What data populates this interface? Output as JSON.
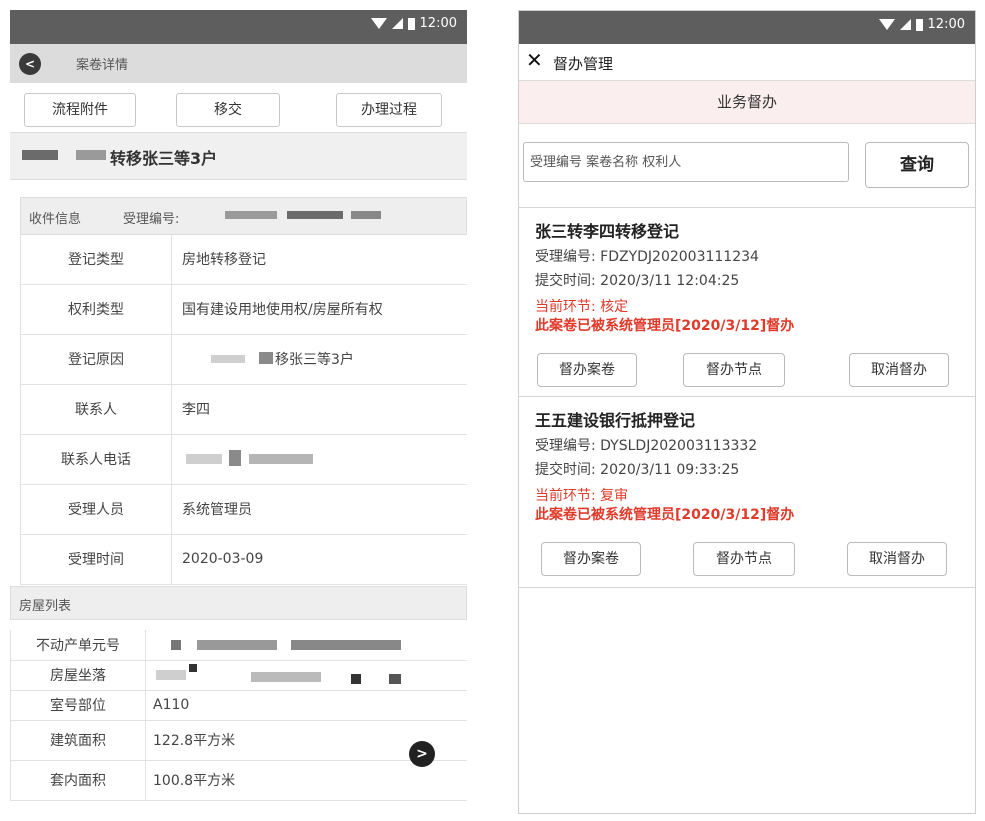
{
  "status": {
    "time": "12:00"
  },
  "left": {
    "nav_title": "案卷详情",
    "tabs": [
      "流程附件",
      "移交",
      "办理过程"
    ],
    "case_title": "转移张三等3户",
    "receipt": {
      "section": "收件信息",
      "receipt_no_label": "受理编号:"
    },
    "fields": [
      {
        "label": "登记类型",
        "value": "房地转移登记"
      },
      {
        "label": "权利类型",
        "value": "国有建设用地使用权/房屋所有权"
      },
      {
        "label": "登记原因",
        "value": "移张三等3户"
      },
      {
        "label": "联系人",
        "value": "李四"
      },
      {
        "label": "联系人电话",
        "value": ""
      },
      {
        "label": "受理人员",
        "value": "系统管理员"
      },
      {
        "label": "受理时间",
        "value": "2020-03-09"
      }
    ],
    "house_section": "房屋列表",
    "house_fields": [
      {
        "label": "不动产单元号",
        "value": ""
      },
      {
        "label": "房屋坐落",
        "value": ""
      },
      {
        "label": "室号部位",
        "value": "A110"
      },
      {
        "label": "建筑面积",
        "value": "122.8平方米"
      },
      {
        "label": "套内面积",
        "value": "100.8平方米"
      }
    ]
  },
  "right": {
    "title": "督办管理",
    "subtitle": "业务督办",
    "search_placeholder": "受理编号 案卷名称 权利人",
    "query_button": "查询",
    "cards": [
      {
        "title": "张三转李四转移登记",
        "receipt_no": "受理编号:  FDZYDJ202003111234",
        "submit_time": "提交时间:  2020/3/11 12:04:25",
        "stage": "当前环节:  核定",
        "notice": "此案卷已被系统管理员[2020/3/12]督办",
        "buttons": [
          "督办案卷",
          "督办节点",
          "取消督办"
        ]
      },
      {
        "title": "王五建设银行抵押登记",
        "receipt_no": "受理编号:  DYSLDJ202003113332",
        "submit_time": "提交时间:  2020/3/11 09:33:25",
        "stage": "当前环节:  复审",
        "notice": "此案卷已被系统管理员[2020/3/12]督办",
        "buttons": [
          "督办案卷",
          "督办节点",
          "取消督办"
        ]
      }
    ]
  },
  "colors": {
    "statusbar": "#5e5e5e",
    "accent_red": "#e03a2a",
    "subtitle_bg": "#fbeeee"
  }
}
